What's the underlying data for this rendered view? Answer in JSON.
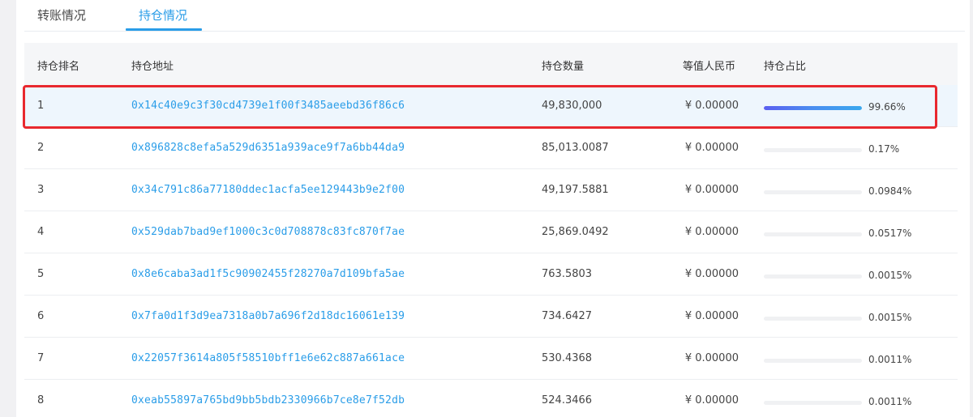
{
  "tabs": {
    "transfer_label": "转账情况",
    "holding_label": "持仓情况"
  },
  "table": {
    "headers": {
      "rank": "持仓排名",
      "address": "持仓地址",
      "quantity": "持仓数量",
      "cny_value": "等值人民币",
      "share": "持仓占比"
    },
    "rows": [
      {
        "rank": "1",
        "address": "0x14c40e9c3f30cd4739e1f00f3485aeebd36f86c6",
        "quantity": "49,830,000",
        "cny": "¥ 0.00000",
        "share_pct": "99.66%",
        "share_value": 99.66
      },
      {
        "rank": "2",
        "address": "0x896828c8efa5a529d6351a939ace9f7a6bb44da9",
        "quantity": "85,013.0087",
        "cny": "¥ 0.00000",
        "share_pct": "0.17%",
        "share_value": 0.17
      },
      {
        "rank": "3",
        "address": "0x34c791c86a77180ddec1acfa5ee129443b9e2f00",
        "quantity": "49,197.5881",
        "cny": "¥ 0.00000",
        "share_pct": "0.0984%",
        "share_value": 0.0984
      },
      {
        "rank": "4",
        "address": "0x529dab7bad9ef1000c3c0d708878c83fc870f7ae",
        "quantity": "25,869.0492",
        "cny": "¥ 0.00000",
        "share_pct": "0.0517%",
        "share_value": 0.0517
      },
      {
        "rank": "5",
        "address": "0x8e6caba3ad1f5c90902455f28270a7d109bfa5ae",
        "quantity": "763.5803",
        "cny": "¥ 0.00000",
        "share_pct": "0.0015%",
        "share_value": 0.0015
      },
      {
        "rank": "6",
        "address": "0x7fa0d1f3d9ea7318a0b7a696f2d18dc16061e139",
        "quantity": "734.6427",
        "cny": "¥ 0.00000",
        "share_pct": "0.0015%",
        "share_value": 0.0015
      },
      {
        "rank": "7",
        "address": "0x22057f3614a805f58510bff1e6e62c887a661ace",
        "quantity": "530.4368",
        "cny": "¥ 0.00000",
        "share_pct": "0.0011%",
        "share_value": 0.0011
      },
      {
        "rank": "8",
        "address": "0xeab55897a765bd9bb5bdb2330966b7ce8e7f52db",
        "quantity": "524.3466",
        "cny": "¥ 0.00000",
        "share_pct": "0.0011%",
        "share_value": 0.0011
      }
    ]
  },
  "colors": {
    "accent": "#2a9de8",
    "highlight_border": "#e8282e",
    "bar_gradient_start": "#5a5ff0",
    "bar_gradient_end": "#3aa8ee"
  }
}
